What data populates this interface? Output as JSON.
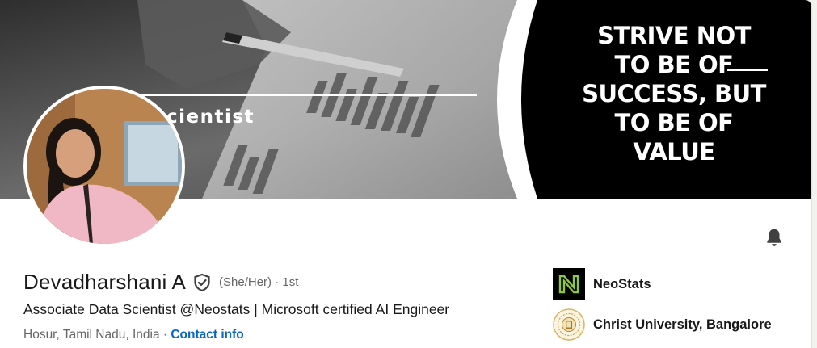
{
  "banner": {
    "quote_lines": [
      "STRIVE NOT",
      "TO BE OF",
      "SUCCESS, BUT",
      "TO BE OF",
      "VALUE"
    ],
    "partial_text": "cientist"
  },
  "profile": {
    "name": "Devadharshani A",
    "pronouns": "(She/Her)",
    "connection_degree": "· 1st",
    "headline": "Associate Data Scientist @Neostats | Microsoft certified AI Engineer",
    "location": "Hosur, Tamil Nadu, India",
    "location_separator": " · ",
    "contact_link": "Contact info"
  },
  "organizations": [
    {
      "name": "NeoStats",
      "icon": "neostats-logo"
    },
    {
      "name": "Christ University, Bangalore",
      "icon": "christ-university-seal"
    }
  ],
  "icons": {
    "verified": "shield-check-icon",
    "notifications": "bell-icon"
  },
  "colors": {
    "link": "#0a66c2",
    "neostats_green": "#8dc63f",
    "text_primary": "#191919",
    "text_secondary": "#666666"
  }
}
